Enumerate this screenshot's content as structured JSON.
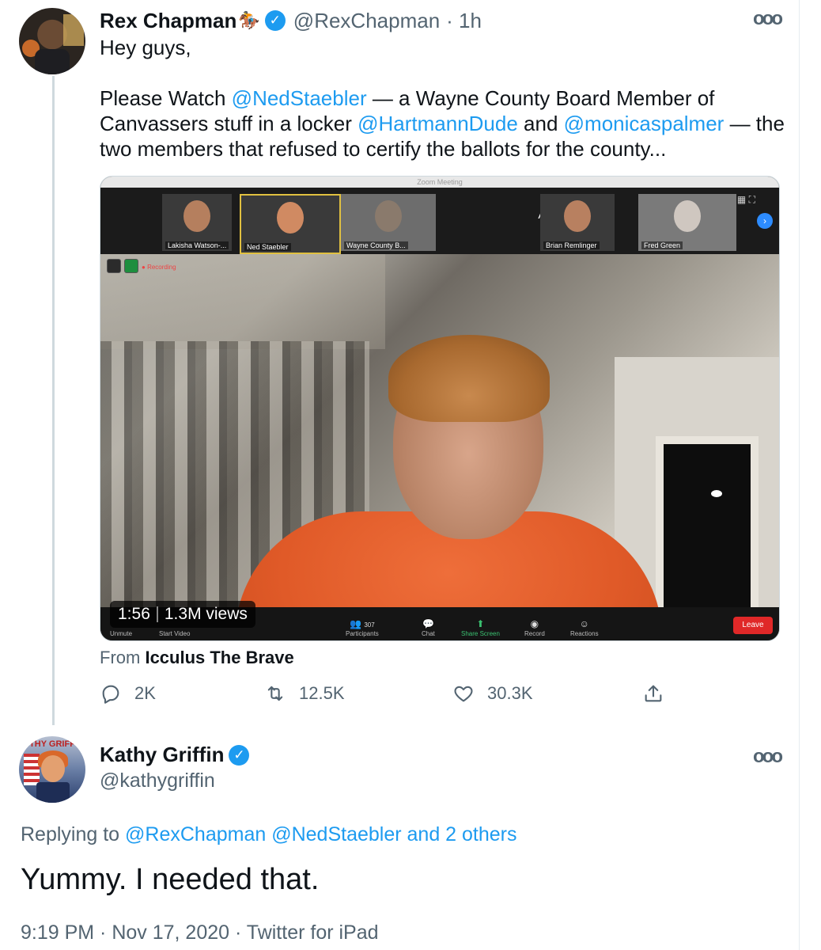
{
  "tweet": {
    "author_name": "Rex Chapman",
    "author_emoji": "🏇",
    "handle": "@RexChapman",
    "time": "· 1h",
    "body": [
      {
        "text": "Hey guys,\n\nPlease Watch ",
        "link": false
      },
      {
        "text": "@NedStaebler",
        "link": true
      },
      {
        "text": " — a Wayne County Board Member of Canvassers stuff in a locker ",
        "link": false
      },
      {
        "text": "@HartmannDude",
        "link": true
      },
      {
        "text": " and ",
        "link": false
      },
      {
        "text": "@monicaspalmer",
        "link": true
      },
      {
        "text": " — the two members that refused to certify the ballots for the county...",
        "link": false
      }
    ],
    "video": {
      "window_title": "Zoom Meeting",
      "participants": [
        "Lakisha Watson-...",
        "Ned Staebler",
        "Wayne County B...",
        "Brian Remlinger",
        "Fred Green"
      ],
      "speaker_label": "Abby Clark",
      "recording_label": "Recording",
      "controls": {
        "unmute": "Unmute",
        "start_video": "Start Video",
        "participants": "Participants",
        "participants_count": "307",
        "chat": "Chat",
        "share_screen": "Share Screen",
        "record": "Record",
        "reactions": "Reactions",
        "leave": "Leave"
      },
      "duration": "1:56",
      "views": "1.3M views"
    },
    "from_prefix": "From",
    "from_source": "Icculus The Brave",
    "actions": {
      "replies": "2K",
      "retweets": "12.5K",
      "likes": "30.3K"
    }
  },
  "reply": {
    "author_name": "Kathy Griffin",
    "handle": "@kathygriffin",
    "avatar_banner": "THY GRIFF",
    "replying_prefix": "Replying to",
    "replying_to": "@RexChapman @NedStaebler and 2 others",
    "text": "Yummy. I needed that.",
    "meta": "9:19 PM · Nov 17, 2020 · Twitter for iPad"
  },
  "colors": {
    "link": "#1d9bf0",
    "secondary_text": "#536471",
    "primary_text": "#0f1419",
    "verified": "#1d9bf0"
  },
  "icons": [
    "verified-badge-icon",
    "more-icon",
    "reply-icon",
    "retweet-icon",
    "like-icon",
    "share-icon"
  ]
}
